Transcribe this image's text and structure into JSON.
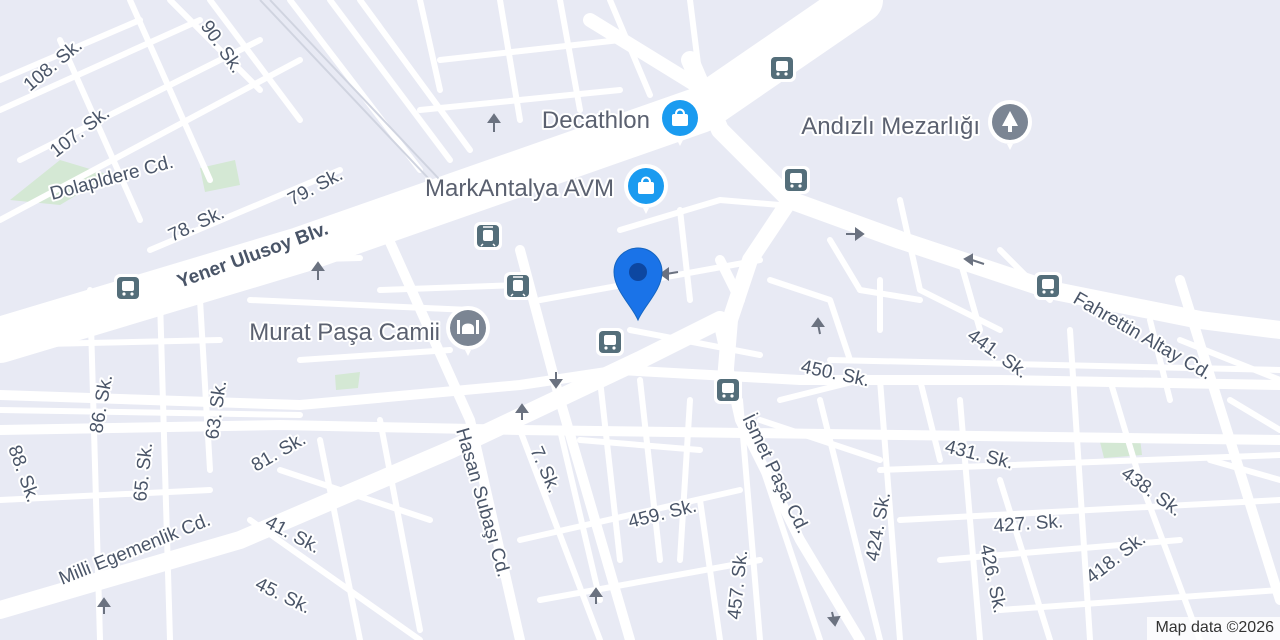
{
  "roads": [
    {
      "id": "yener-ulusoy",
      "label": "Yener Ulusoy Blv."
    },
    {
      "id": "milli-egemenlik",
      "label": "Milli Egemenlik Cd."
    },
    {
      "id": "hasan-subasi",
      "label": "Hasan Subaşı Cd."
    },
    {
      "id": "ismet-pasa",
      "label": "İsmet Paşa Cd."
    },
    {
      "id": "fahrettin-altay",
      "label": "Fahrettin Altay Cd."
    },
    {
      "id": "dolapldere",
      "label": "Dolapldere Cd."
    },
    {
      "id": "s108",
      "label": "108. Sk."
    },
    {
      "id": "s107",
      "label": "107. Sk."
    },
    {
      "id": "s90",
      "label": "90. Sk."
    },
    {
      "id": "s79",
      "label": "79. Sk."
    },
    {
      "id": "s78",
      "label": "78. Sk."
    },
    {
      "id": "s86",
      "label": "86. Sk."
    },
    {
      "id": "s65",
      "label": "65. Sk."
    },
    {
      "id": "s63",
      "label": "63. Sk."
    },
    {
      "id": "s88",
      "label": "88. Sk."
    },
    {
      "id": "s81",
      "label": "81. Sk."
    },
    {
      "id": "s41",
      "label": "41. Sk."
    },
    {
      "id": "s45",
      "label": "45. Sk."
    },
    {
      "id": "s7",
      "label": "7. Sk."
    },
    {
      "id": "s459",
      "label": "459. Sk."
    },
    {
      "id": "s457",
      "label": "457. Sk."
    },
    {
      "id": "s450",
      "label": "450. Sk."
    },
    {
      "id": "s441",
      "label": "441. Sk."
    },
    {
      "id": "s431",
      "label": "431. Sk."
    },
    {
      "id": "s438",
      "label": "438. Sk."
    },
    {
      "id": "s427",
      "label": "427. Sk."
    },
    {
      "id": "s424",
      "label": "424. Sk."
    },
    {
      "id": "s426",
      "label": "426. Sk."
    },
    {
      "id": "s418",
      "label": "418. Sk."
    }
  ],
  "pois": [
    {
      "id": "decathlon",
      "label": "Decathlon",
      "category": "shopping",
      "icon": "shopping-bag-icon",
      "color": "#1a9bf0"
    },
    {
      "id": "markantalya",
      "label": "MarkAntalya AVM",
      "category": "shopping",
      "icon": "shopping-bag-icon",
      "color": "#1a9bf0"
    },
    {
      "id": "andizli",
      "label": "Andızlı Mezarlığı",
      "category": "cemetery",
      "icon": "tree-icon",
      "color": "#7b8593"
    },
    {
      "id": "murat-pasa",
      "label": "Murat Paşa Camii",
      "category": "mosque",
      "icon": "mosque-icon",
      "color": "#7b8593"
    }
  ],
  "transit": [
    {
      "id": "bus-1",
      "type": "bus",
      "icon": "bus-stop-icon"
    },
    {
      "id": "bus-2",
      "type": "bus",
      "icon": "bus-stop-icon"
    },
    {
      "id": "bus-3",
      "type": "bus",
      "icon": "bus-stop-icon"
    },
    {
      "id": "bus-4",
      "type": "bus",
      "icon": "bus-stop-icon"
    },
    {
      "id": "bus-5",
      "type": "bus",
      "icon": "bus-stop-icon"
    },
    {
      "id": "bus-6",
      "type": "bus",
      "icon": "bus-stop-icon"
    },
    {
      "id": "tram-1",
      "type": "tram",
      "icon": "tram-stop-icon"
    },
    {
      "id": "tram-2",
      "type": "tram",
      "icon": "tram-stop-icon"
    }
  ],
  "marker": {
    "icon": "location-pin-icon",
    "color": "#1a73e8"
  },
  "colors": {
    "land": "#e8eaf4",
    "road": "#ffffff",
    "park": "#d4e8d4",
    "marker": "#1a73e8",
    "poi_shopping": "#1a9bf0",
    "poi_generic": "#7b8593",
    "transit": "#546e7a"
  },
  "attribution": "Map data ©2026"
}
